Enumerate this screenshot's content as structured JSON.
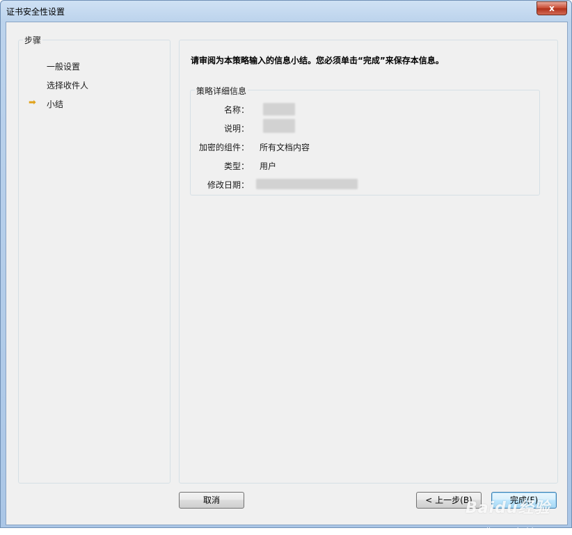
{
  "window": {
    "title": "证书安全性设置",
    "close_glyph": "x"
  },
  "steps": {
    "title": "步骤",
    "items": [
      "一般设置",
      "选择收件人",
      "小结"
    ],
    "current_marker_icon": "arrow-right-icon"
  },
  "content": {
    "heading": "请审阅为本策略输入的信息小结。您必须单击“完成”来保存本信息。",
    "group_title": "策略详细信息",
    "rows": [
      {
        "label": "名称：",
        "value": ""
      },
      {
        "label": "说明：",
        "value": ""
      },
      {
        "label": "加密的组件：",
        "value": "所有文档内容"
      },
      {
        "label": "类型：",
        "value": "用户"
      },
      {
        "label": "修改日期：",
        "value": ""
      }
    ]
  },
  "buttons": {
    "cancel": "取消",
    "back": "< 上一步(B)",
    "finish": "完成(F)"
  },
  "watermark": {
    "logo": "Baidu经验",
    "url": "jingyan.baidu.com"
  }
}
